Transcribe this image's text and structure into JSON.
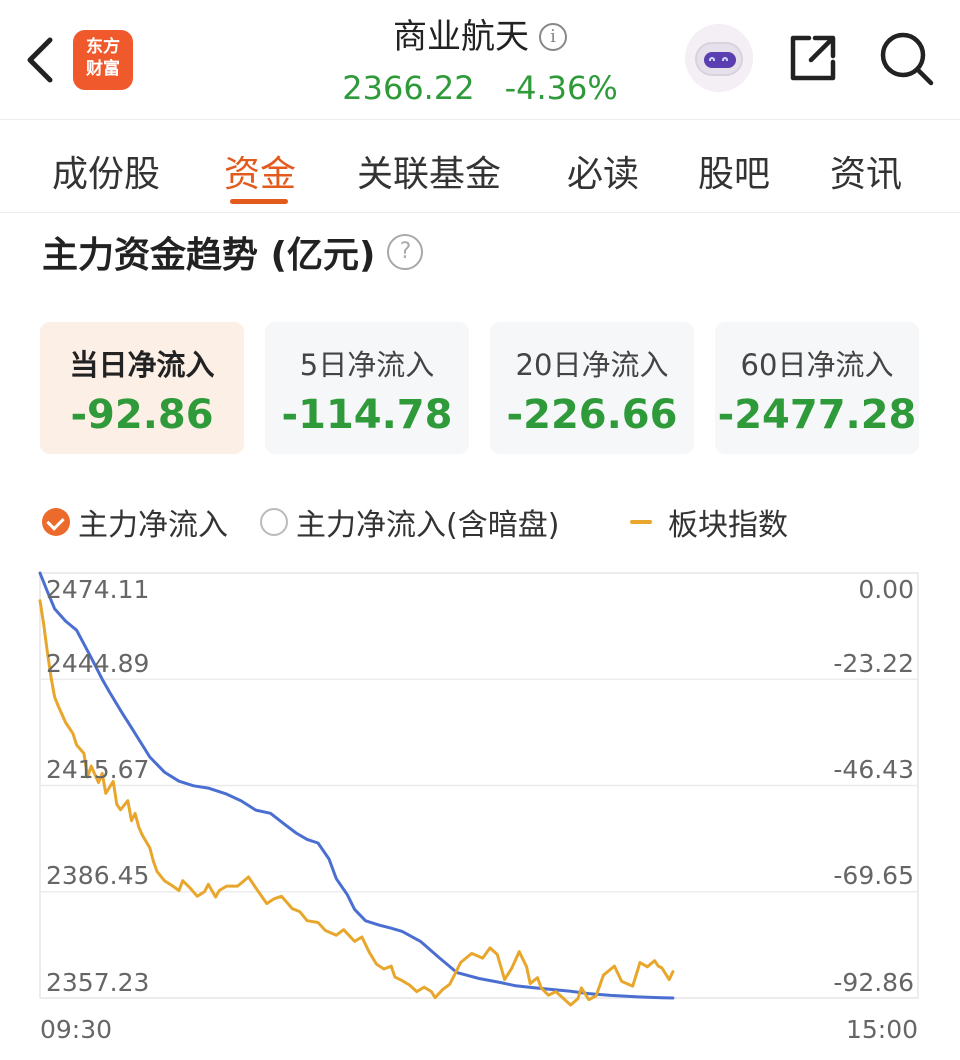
{
  "header": {
    "logo_line1": "东方",
    "logo_line2": "财富",
    "title": "商业航天",
    "price": "2366.22",
    "change_pct": "-4.36%",
    "price_color": "#2f9a39"
  },
  "tabs": [
    {
      "label": "成份股",
      "active": false
    },
    {
      "label": "资金",
      "active": true
    },
    {
      "label": "关联基金",
      "active": false
    },
    {
      "label": "必读",
      "active": false
    },
    {
      "label": "股吧",
      "active": false
    },
    {
      "label": "资讯",
      "active": false
    }
  ],
  "section": {
    "title": "主力资金趋势 (亿元)",
    "help": "?"
  },
  "cards": [
    {
      "label": "当日净流入",
      "value": "-92.86",
      "selected": true
    },
    {
      "label": "5日净流入",
      "value": "-114.78",
      "selected": false
    },
    {
      "label": "20日净流入",
      "value": "-226.66",
      "selected": false
    },
    {
      "label": "60日净流入",
      "value": "-2477.28",
      "selected": false
    }
  ],
  "legend": {
    "item1": "主力净流入",
    "item2": "主力净流入(含暗盘)",
    "item3": "板块指数"
  },
  "chart_data": {
    "type": "line",
    "x_labels": [
      "09:30",
      "15:00"
    ],
    "left_axis_ticks": [
      "2474.11",
      "2444.89",
      "2415.67",
      "2386.45",
      "2357.23"
    ],
    "right_axis_ticks": [
      "0.00",
      "-23.22",
      "-46.43",
      "-69.65",
      "-92.86"
    ],
    "left_ylim": [
      2357.23,
      2474.11
    ],
    "right_ylim": [
      -92.86,
      0.0
    ],
    "x_range_minutes": 240,
    "grid": true,
    "series": [
      {
        "name": "主力净流入",
        "axis": "right",
        "color": "#4a6fd0",
        "x": [
          0,
          2,
          4,
          7,
          10,
          14,
          17,
          19,
          22,
          25,
          30,
          34,
          38,
          42,
          46,
          51,
          55,
          59,
          63,
          67,
          70,
          73,
          76,
          79,
          81,
          84,
          86,
          89,
          93,
          96,
          99,
          104,
          109,
          114,
          120,
          126,
          130,
          135,
          140,
          145,
          150,
          156,
          161,
          166,
          170,
          173
        ],
        "values": [
          0.0,
          -4.0,
          -7.8,
          -10.5,
          -12.5,
          -18.5,
          -23.2,
          -26.0,
          -30.0,
          -33.8,
          -40.2,
          -43.5,
          -45.5,
          -46.5,
          -47.0,
          -48.3,
          -49.8,
          -51.8,
          -52.5,
          -55.0,
          -56.8,
          -58.2,
          -59.0,
          -62.5,
          -66.8,
          -70.3,
          -73.5,
          -76.0,
          -77.0,
          -77.6,
          -78.3,
          -80.5,
          -84.0,
          -87.3,
          -88.6,
          -89.5,
          -90.2,
          -90.6,
          -91.0,
          -91.4,
          -91.9,
          -92.3,
          -92.5,
          -92.7,
          -92.8,
          -92.86
        ]
      },
      {
        "name": "板块指数",
        "axis": "left",
        "color": "#e8a72c",
        "x": [
          0,
          1,
          2,
          3,
          4,
          5,
          7,
          9,
          10,
          12,
          13,
          14,
          16,
          17,
          18,
          20,
          21,
          22,
          24,
          25,
          26,
          27,
          28,
          30,
          31,
          32,
          34,
          36,
          38,
          39,
          41,
          43,
          45,
          46,
          48,
          49,
          51,
          54,
          57,
          59,
          62,
          64,
          66,
          69,
          71,
          73,
          76,
          78,
          81,
          83,
          86,
          88,
          90,
          92,
          94,
          96,
          97,
          99,
          101,
          103,
          105,
          107,
          108,
          110,
          112,
          113,
          115,
          118,
          121,
          123,
          125,
          127,
          129,
          131,
          133,
          134,
          136,
          137,
          139,
          141,
          143,
          145,
          147,
          148,
          150,
          152,
          154,
          157,
          159,
          162,
          164,
          166,
          168,
          169,
          170,
          172,
          173
        ],
        "values": [
          2466.5,
          2460.0,
          2452.5,
          2445.5,
          2440.0,
          2437.5,
          2433.0,
          2430.0,
          2426.8,
          2424.5,
          2418.0,
          2421.0,
          2416.5,
          2419.0,
          2413.5,
          2416.8,
          2410.5,
          2409.0,
          2411.5,
          2406.0,
          2408.0,
          2404.2,
          2402.0,
          2398.5,
          2394.8,
          2392.0,
          2389.5,
          2388.2,
          2386.8,
          2389.5,
          2387.5,
          2385.2,
          2386.5,
          2388.5,
          2385.0,
          2386.8,
          2388.0,
          2388.0,
          2390.5,
          2387.5,
          2383.2,
          2384.5,
          2385.2,
          2381.8,
          2381.0,
          2378.5,
          2378.0,
          2375.8,
          2374.5,
          2376.0,
          2372.8,
          2374.0,
          2369.8,
          2366.5,
          2365.2,
          2366.0,
          2363.0,
          2362.0,
          2360.8,
          2359.0,
          2360.2,
          2359.0,
          2357.3,
          2359.5,
          2361.0,
          2363.0,
          2367.0,
          2369.5,
          2368.2,
          2371.0,
          2369.2,
          2362.3,
          2365.5,
          2370.0,
          2365.8,
          2361.2,
          2362.8,
          2360.0,
          2358.0,
          2359.0,
          2357.2,
          2355.3,
          2357.0,
          2360.0,
          2356.8,
          2357.8,
          2363.5,
          2366.0,
          2361.8,
          2360.5,
          2367.0,
          2365.8,
          2367.5,
          2366.0,
          2365.5,
          2362.3,
          2364.5
        ]
      }
    ]
  }
}
